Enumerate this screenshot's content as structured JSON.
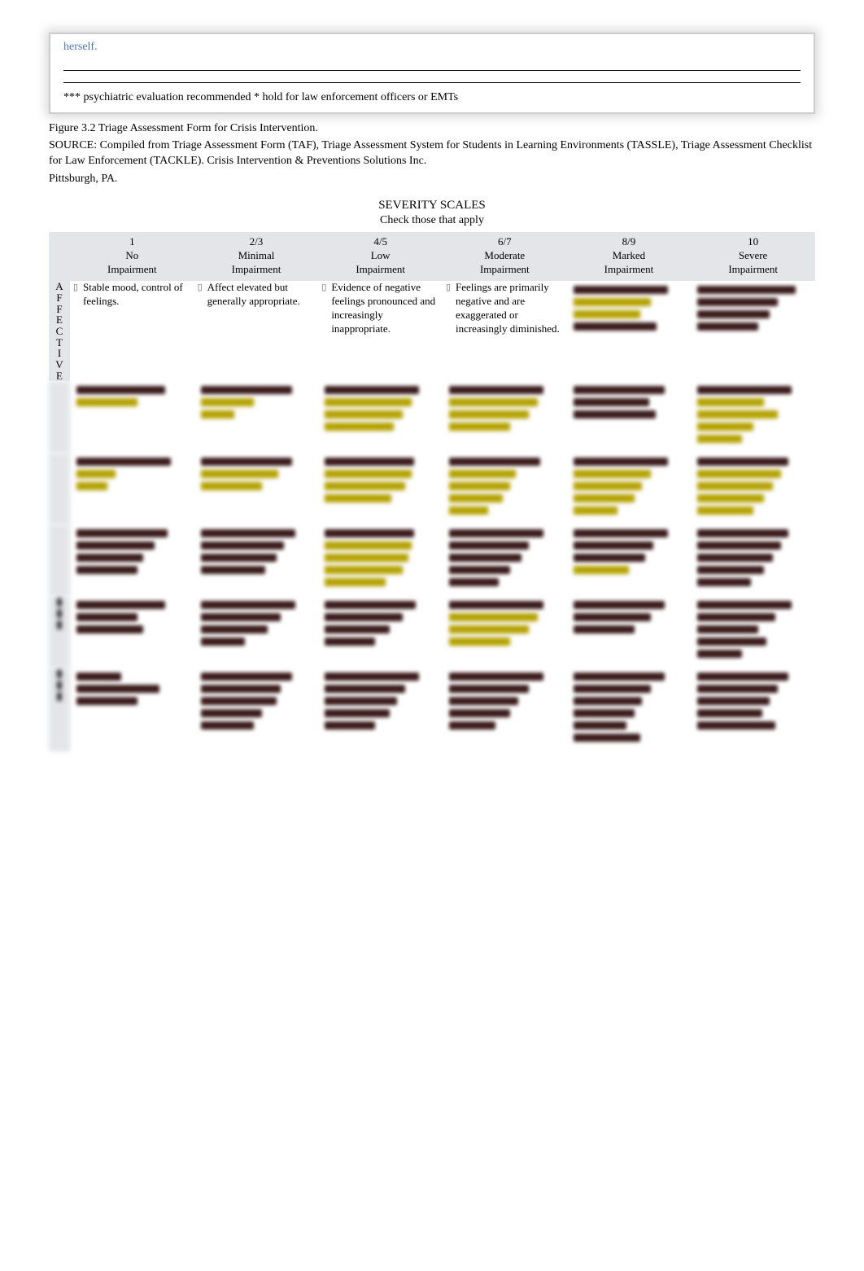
{
  "top_box": {
    "herself": "herself.",
    "footnote": "*** psychiatric evaluation recommended * hold for law enforcement officers or EMTs"
  },
  "figure_caption": "Figure 3.2  Triage Assessment Form for Crisis Intervention.",
  "source": "SOURCE: Compiled from Triage Assessment Form (TAF), Triage Assessment System for Students in Learning Environments (TASSLE), Triage Assessment Checklist for Law Enforcement (TACKLE). Crisis Intervention & Preventions Solutions Inc.",
  "location": "Pittsburgh, PA.",
  "severity_title": "SEVERITY SCALES",
  "severity_subtitle": "Check those that apply",
  "columns": [
    {
      "num": "1",
      "label1": "No",
      "label2": "Impairment"
    },
    {
      "num": "2/3",
      "label1": "Minimal",
      "label2": "Impairment"
    },
    {
      "num": "4/5",
      "label1": "Low",
      "label2": "Impairment"
    },
    {
      "num": "6/7",
      "label1": "Moderate",
      "label2": "Impairment"
    },
    {
      "num": "8/9",
      "label1": "Marked",
      "label2": "Impairment"
    },
    {
      "num": "10",
      "label1": "Severe",
      "label2": "Impairment"
    }
  ],
  "row_labels": [
    "AFFECTIVE",
    "",
    "",
    "",
    "",
    ""
  ],
  "affective_row": {
    "c1": "Stable mood, control of feelings.",
    "c2": "Affect elevated but generally appropriate.",
    "c3": "Evidence of negative feelings pronounced and increasingly inappropriate.",
    "c4": "Feelings are primarily negative and are exaggerated or increasingly diminished."
  },
  "chart_data": {
    "type": "table",
    "title": "SEVERITY SCALES — Check those that apply",
    "columns": [
      "1 No Impairment",
      "2/3 Minimal Impairment",
      "4/5 Low Impairment",
      "6/7 Moderate Impairment",
      "8/9 Marked Impairment",
      "10 Severe Impairment"
    ],
    "rows": [
      {
        "label": "AFFECTIVE",
        "cells": [
          "Stable mood, control of feelings.",
          "Affect elevated but generally appropriate.",
          "Evidence of negative feelings pronounced and increasingly inappropriate.",
          "Feelings are primarily negative and are exaggerated or increasingly diminished.",
          "(obscured)",
          "(obscured)"
        ]
      },
      {
        "label": "(obscured)",
        "cells": [
          "(obscured)",
          "(obscured)",
          "(obscured)",
          "(obscured)",
          "(obscured)",
          "(obscured)"
        ]
      },
      {
        "label": "(obscured)",
        "cells": [
          "(obscured)",
          "(obscured)",
          "(obscured)",
          "(obscured)",
          "(obscured)",
          "(obscured)"
        ]
      },
      {
        "label": "(obscured)",
        "cells": [
          "(obscured)",
          "(obscured)",
          "(obscured)",
          "(obscured)",
          "(obscured)",
          "(obscured)"
        ]
      },
      {
        "label": "(obscured)",
        "cells": [
          "(obscured)",
          "(obscured)",
          "(obscured)",
          "(obscured)",
          "(obscured)",
          "(obscured)"
        ]
      },
      {
        "label": "(obscured)",
        "cells": [
          "(obscured)",
          "(obscured)",
          "(obscured)",
          "(obscured)",
          "(obscured)",
          "(obscured)"
        ]
      }
    ]
  }
}
